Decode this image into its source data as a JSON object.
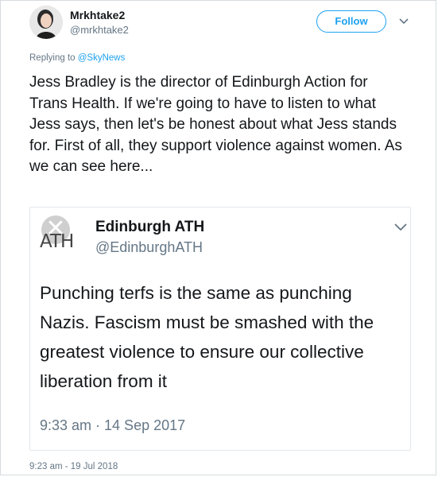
{
  "tweet": {
    "display_name": "Mrkhtake2",
    "handle": "@mrkhtake2",
    "follow_label": "Follow",
    "reply_prefix": "Replying to ",
    "reply_mention": "@SkyNews",
    "text": "Jess Bradley is the director of Edinburgh Action for Trans Health. If we're going to have to listen to what Jess says, then let's be honest about what Jess stands for. First of all, they support violence against women. As we can see here...",
    "timestamp": "9:23 am - 19 Jul 2018"
  },
  "quoted_tweet": {
    "display_name": "Edinburgh ATH",
    "handle": "@EdinburghATH",
    "avatar_text": "ATH",
    "text": "Punching terfs is the same as punching Nazis. Fascism must be smashed with the greatest violence to ensure our collective liberation from it",
    "timestamp": "9:33 am · 14 Sep 2017"
  },
  "icons": {
    "caret": "chevron-down-icon",
    "quote_avatar": "x-mark"
  },
  "colors": {
    "accent": "#1da1f2",
    "text": "#14171a",
    "muted": "#657786",
    "border": "#e1e8ed"
  }
}
